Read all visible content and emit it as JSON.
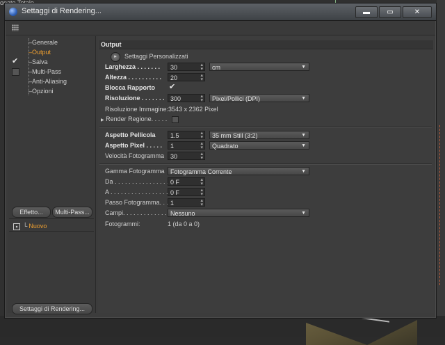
{
  "background": {
    "viewport_label": "onato Totale"
  },
  "window": {
    "title": "Settaggi di Rendering...",
    "buttons": {
      "minimize": "▬",
      "maximize": "▭",
      "close": "✕"
    }
  },
  "left": {
    "tree": [
      {
        "label": "Generale",
        "checked": null,
        "selected": false
      },
      {
        "label": "Output",
        "checked": null,
        "selected": true
      },
      {
        "label": "Salva",
        "checked": true,
        "selected": false
      },
      {
        "label": "Multi-Pass",
        "checked": false,
        "selected": false
      },
      {
        "label": "Anti-Aliasing",
        "checked": null,
        "selected": false
      },
      {
        "label": "Opzioni",
        "checked": null,
        "selected": false
      }
    ],
    "effetto_button": "Effetto...",
    "multipass_button": "Multi-Pass...",
    "preset_item": "Nuovo",
    "render_settings_button": "Settaggi di Rendering..."
  },
  "output": {
    "section_title": "Output",
    "preset_label": "Settaggi Personalizzati",
    "larghezza": {
      "label": "Larghezza . . . . . . .",
      "value": "30",
      "unit": "cm"
    },
    "altezza": {
      "label": "Altezza . . . . . . . . . .",
      "value": "20"
    },
    "blocca": {
      "label": "Blocca Rapporto",
      "checked": true
    },
    "risoluzione": {
      "label": "Risoluzione . . . . . . .",
      "value": "300",
      "unit": "Pixel/Pollici (DPI)"
    },
    "risoluzione_immagine": {
      "label": "Risoluzione Immagine:",
      "value": "3543 x 2362 Pixel"
    },
    "render_regione": {
      "label": "Render Regione. . . . .",
      "checked": false
    },
    "aspetto_pellicola": {
      "label": "Aspetto Pellicola",
      "value": "1.5",
      "preset": "35 mm Still (3:2)"
    },
    "aspetto_pixel": {
      "label": "Aspetto Pixel . . . . .",
      "value": "1",
      "preset": "Quadrato"
    },
    "velocita": {
      "label": "Velocità Fotogramma",
      "value": "30"
    },
    "gamma": {
      "label": "Gamma Fotogramma",
      "value": "Fotogramma Corrente"
    },
    "da": {
      "label": "Da . . . . . . . . . . . . . . . .",
      "value": "0 F"
    },
    "a": {
      "label": "A . . . . . . . . . . . . . . . . .",
      "value": "0 F"
    },
    "passo": {
      "label": "Passo Fotogramma. . .",
      "value": "1"
    },
    "campi": {
      "label": "Campi. . . . . . . . . . . . .",
      "value": "Nessuno"
    },
    "fotogrammi": {
      "label": "Fotogrammi:",
      "value": "1 (da 0 a 0)"
    }
  }
}
